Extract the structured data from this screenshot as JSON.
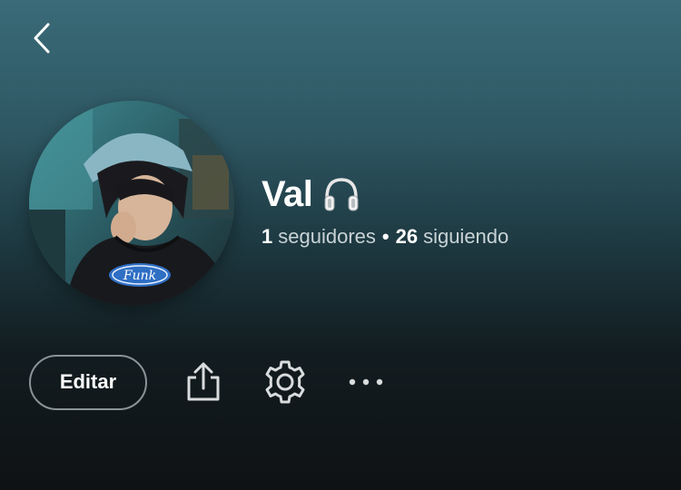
{
  "header": {
    "back_icon": "chevron-left-icon"
  },
  "profile": {
    "name": "Val",
    "name_emoji": "🎧",
    "followers_count": "1",
    "followers_label": "seguidores",
    "separator": "•",
    "following_count": "26",
    "following_label": "siguiendo",
    "avatar_print_text": "Funk"
  },
  "actions": {
    "edit_label": "Editar",
    "share_icon": "share-icon",
    "settings_icon": "gear-icon",
    "more_icon": "more-horizontal-icon"
  },
  "colors": {
    "gradient_top": "#3a6b78",
    "gradient_bottom": "#0f1214",
    "text_primary": "#ffffff",
    "text_secondary": "#c9d3d6",
    "button_border": "#8a9396"
  }
}
